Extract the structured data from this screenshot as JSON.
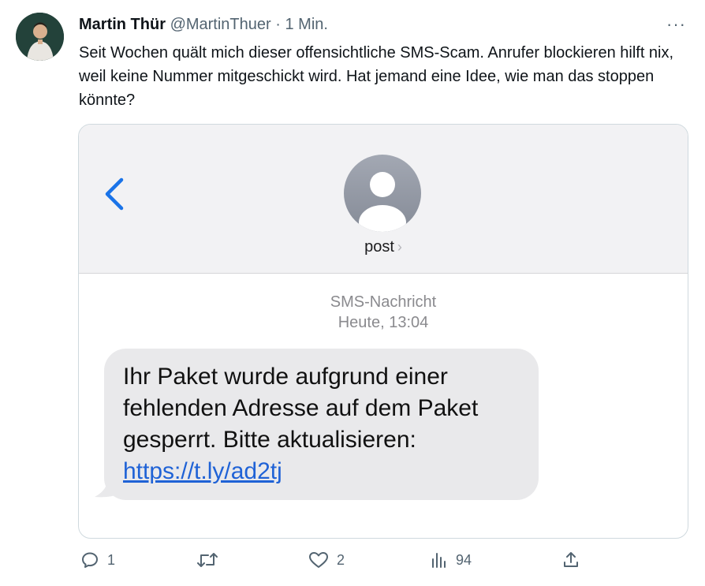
{
  "tweet": {
    "author_name": "Martin Thür",
    "handle": "@MartinThuer",
    "separator": "·",
    "time": "1 Min.",
    "more": "···",
    "text": "Seit Wochen quält mich dieser offensichtliche SMS-Scam. Anrufer blockieren hilft nix, weil keine Nummer mitgeschickt wird. Hat jemand eine Idee, wie man das stoppen könnte?"
  },
  "sms": {
    "contact": "post",
    "contact_chevron": "›",
    "type_label": "SMS-Nachricht",
    "timestamp": "Heute, 13:04",
    "message": "Ihr Paket wurde aufgrund einer fehlenden Adresse auf dem Paket gesperrt. Bitte aktualisieren:",
    "link": "https://t.ly/ad2tj",
    "colors": {
      "link": "#1f62d6",
      "bubble": "#e9e9eb",
      "back": "#1a73e8"
    }
  },
  "actions": {
    "replies": "1",
    "retweets": "",
    "likes": "2",
    "views": "94"
  }
}
